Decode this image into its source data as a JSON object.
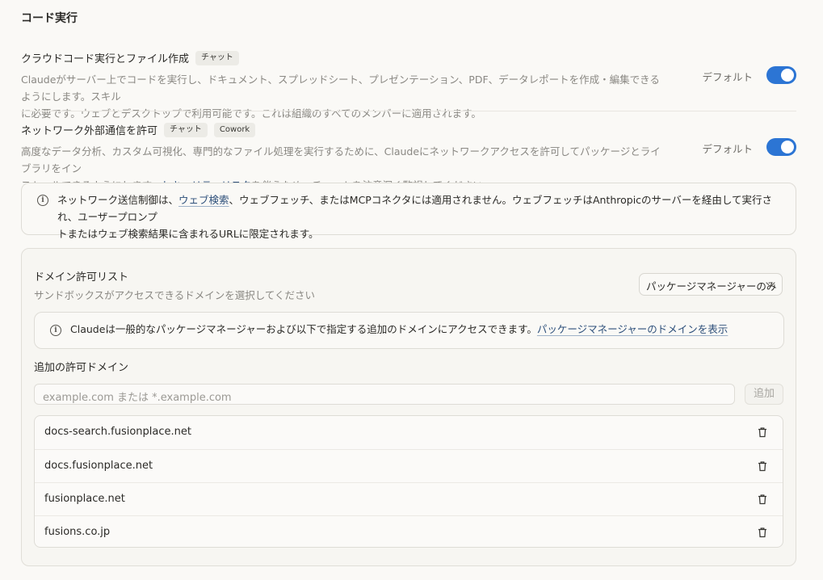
{
  "section_title": "コード実行",
  "code_exec": {
    "title": "クラウドコード実行とファイル作成",
    "tag": "チャット",
    "desc_line1": "Claudeがサーバー上でコードを実行し、ドキュメント、スプレッドシート、プレゼンテーション、PDF、データレポートを作成・編集できるようにします。スキル",
    "desc_line2": "に必要です。ウェブとデスクトップで利用可能です。これは組織のすべてのメンバーに適用されます。",
    "default_label": "デフォルト",
    "enabled": true
  },
  "network": {
    "title": "ネットワーク外部通信を許可",
    "tags": [
      "チャット",
      "Cowork"
    ],
    "desc_line1": "高度なデータ分析、カスタム可視化、専門的なファイル処理を実行するために、Claudeにネットワークアクセスを許可してパッケージとライブラリをイン",
    "desc_line2_a": "ストールできるようにします。",
    "desc_link": "セキュリティリスク",
    "desc_line2_b": "を伴うため、チャットを注意深く監視してください。",
    "default_label": "デフォルト",
    "enabled": true
  },
  "network_notice": {
    "a": "ネットワーク送信制御は、",
    "link": "ウェブ検索",
    "b": "、ウェブフェッチ、またはMCPコネクタには適用されません。ウェブフェッチはAnthropicのサーバーを経由して実行され、ユーザープロンプ",
    "c": "トまたはウェブ検索結果に含まれるURLに限定されます。"
  },
  "allowlist": {
    "title": "ドメイン許可リスト",
    "subtitle": "サンドボックスがアクセスできるドメインを選択してください",
    "dropdown_value": "パッケージマネージャーのみ",
    "notice_text": "Claudeは一般的なパッケージマネージャーおよび以下で指定する追加のドメインにアクセスできます。",
    "notice_link": "パッケージマネージャーのドメインを表示",
    "additional_label": "追加の許可ドメイン",
    "input_placeholder": "example.com または *.example.com",
    "add_button": "追加",
    "domains": [
      "docs-search.fusionplace.net",
      "docs.fusionplace.net",
      "fusionplace.net",
      "fusions.co.jp"
    ]
  },
  "colors": {
    "toggle_on": "#2c75d4",
    "link": "#2d4f7a"
  }
}
